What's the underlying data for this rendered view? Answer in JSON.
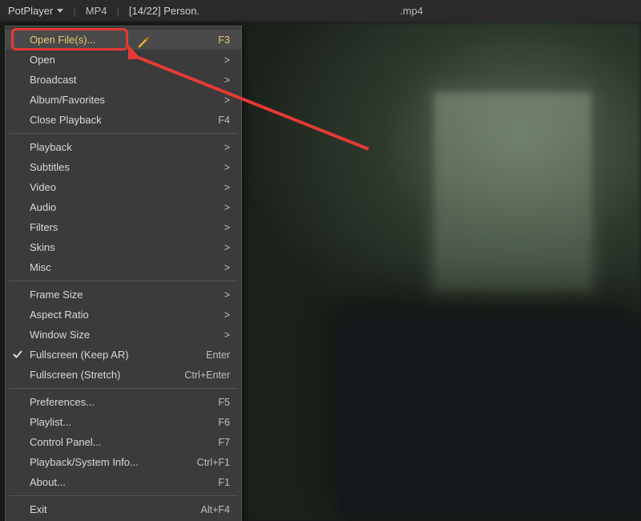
{
  "titlebar": {
    "app_name": "PotPlayer",
    "format_badge": "MP4",
    "file_label_prefix": "[14/22] Person.",
    "file_label_suffix": ".mp4"
  },
  "menu": {
    "groups": [
      [
        {
          "id": "open-files",
          "label": "Open File(s)...",
          "accel": "F3",
          "submenu": false,
          "checked": false,
          "highlight": true
        },
        {
          "id": "open",
          "label": "Open",
          "accel": "",
          "submenu": true,
          "checked": false
        },
        {
          "id": "broadcast",
          "label": "Broadcast",
          "accel": "",
          "submenu": true,
          "checked": false
        },
        {
          "id": "album-fav",
          "label": "Album/Favorites",
          "accel": "",
          "submenu": true,
          "checked": false
        },
        {
          "id": "close-playback",
          "label": "Close Playback",
          "accel": "F4",
          "submenu": false,
          "checked": false
        }
      ],
      [
        {
          "id": "playback",
          "label": "Playback",
          "accel": "",
          "submenu": true,
          "checked": false
        },
        {
          "id": "subtitles",
          "label": "Subtitles",
          "accel": "",
          "submenu": true,
          "checked": false
        },
        {
          "id": "video",
          "label": "Video",
          "accel": "",
          "submenu": true,
          "checked": false
        },
        {
          "id": "audio",
          "label": "Audio",
          "accel": "",
          "submenu": true,
          "checked": false
        },
        {
          "id": "filters",
          "label": "Filters",
          "accel": "",
          "submenu": true,
          "checked": false
        },
        {
          "id": "skins",
          "label": "Skins",
          "accel": "",
          "submenu": true,
          "checked": false
        },
        {
          "id": "misc",
          "label": "Misc",
          "accel": "",
          "submenu": true,
          "checked": false
        }
      ],
      [
        {
          "id": "frame-size",
          "label": "Frame Size",
          "accel": "",
          "submenu": true,
          "checked": false
        },
        {
          "id": "aspect-ratio",
          "label": "Aspect Ratio",
          "accel": "",
          "submenu": true,
          "checked": false
        },
        {
          "id": "window-size",
          "label": "Window Size",
          "accel": "",
          "submenu": true,
          "checked": false
        },
        {
          "id": "fullscreen-ar",
          "label": "Fullscreen (Keep AR)",
          "accel": "Enter",
          "submenu": false,
          "checked": true
        },
        {
          "id": "fullscreen-str",
          "label": "Fullscreen (Stretch)",
          "accel": "Ctrl+Enter",
          "submenu": false,
          "checked": false
        }
      ],
      [
        {
          "id": "preferences",
          "label": "Preferences...",
          "accel": "F5",
          "submenu": false,
          "checked": false
        },
        {
          "id": "playlist",
          "label": "Playlist...",
          "accel": "F6",
          "submenu": false,
          "checked": false
        },
        {
          "id": "control-panel",
          "label": "Control Panel...",
          "accel": "F7",
          "submenu": false,
          "checked": false
        },
        {
          "id": "sysinfo",
          "label": "Playback/System Info...",
          "accel": "Ctrl+F1",
          "submenu": false,
          "checked": false
        },
        {
          "id": "about",
          "label": "About...",
          "accel": "F1",
          "submenu": false,
          "checked": false
        }
      ],
      [
        {
          "id": "exit",
          "label": "Exit",
          "accel": "Alt+F4",
          "submenu": false,
          "checked": false
        }
      ]
    ],
    "submenu_glyph": ">"
  },
  "annotation": {
    "color": "#e53a34"
  }
}
